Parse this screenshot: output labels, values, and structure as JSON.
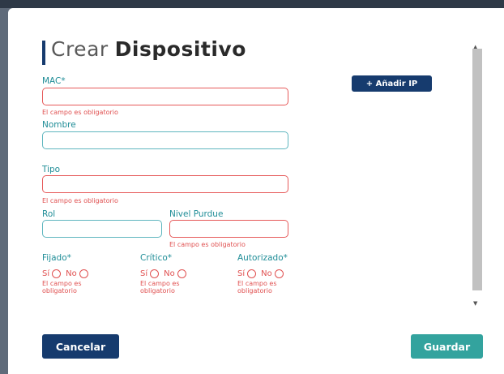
{
  "dialog": {
    "title_light": "Crear",
    "title_bold": "Dispositivo"
  },
  "form": {
    "mac": {
      "label": "MAC*",
      "value": "",
      "error": "El campo es obligatorio"
    },
    "nombre": {
      "label": "Nombre",
      "value": ""
    },
    "tipo": {
      "label": "Tipo",
      "value": "",
      "error": "El campo es obligatorio"
    },
    "rol": {
      "label": "Rol",
      "value": ""
    },
    "nivel_purdue": {
      "label": "Nivel Purdue",
      "value": "",
      "error": "El campo es obligatorio"
    },
    "fijado": {
      "label": "Fijado*",
      "yes": "Sí",
      "no": "No",
      "error_line1": "El campo es",
      "error_line2": "obligatorio"
    },
    "critico": {
      "label": "Crítico*",
      "yes": "Sí",
      "no": "No",
      "error_line1": "El campo es",
      "error_line2": "obligatorio"
    },
    "autorizado": {
      "label": "Autorizado*",
      "yes": "Sí",
      "no": "No",
      "error_line1": "El campo es",
      "error_line2": "obligatorio"
    }
  },
  "buttons": {
    "add_ip": "+ Añadir IP",
    "cancel": "Cancelar",
    "save": "Guardar"
  },
  "colors": {
    "primary": "#163b6e",
    "accent": "#33a39e",
    "error": "#e05050",
    "label": "#1f8d97"
  },
  "scrollbar": {
    "up_icon": "▲",
    "down_icon": "▼"
  }
}
